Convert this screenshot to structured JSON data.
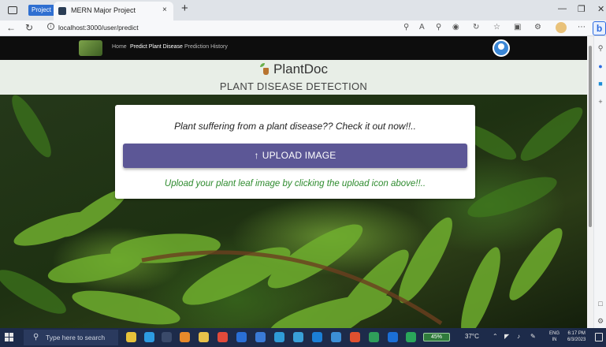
{
  "browser": {
    "window_badge": "Project",
    "tab": {
      "title": "MERN Major Project",
      "close": "×"
    },
    "new_tab": "+",
    "address": "localhost:3000/user/predict",
    "edge_button": "b"
  },
  "navbar": {
    "links": [
      "Home",
      "Predict Plant Disease",
      "Prediction History"
    ],
    "active_link": "Predict Plant Disease"
  },
  "brand": {
    "name": "PlantDoc",
    "subtitle": "PLANT DISEASE DETECTION"
  },
  "card": {
    "question": "Plant suffering from a plant disease?? Check it out now!!..",
    "upload_arrow": "↑",
    "upload_label": "UPLOAD IMAGE",
    "hint": "Upload your plant leaf image by clicking the upload icon above!!.."
  },
  "taskbar": {
    "search_placeholder": "Type here to search",
    "battery": "45%",
    "temperature": "37°C",
    "lang_top": "ENG",
    "lang_bottom": "IN",
    "time": "6:17 PM",
    "date": "6/3/2023"
  },
  "colors": {
    "upload_button": "#5c5796",
    "hint_text": "#2e8b2e",
    "navbar_bg": "#0d0d0d",
    "brandbar_bg": "#e8eee7",
    "taskbar_bg": "#1d2b4a"
  }
}
